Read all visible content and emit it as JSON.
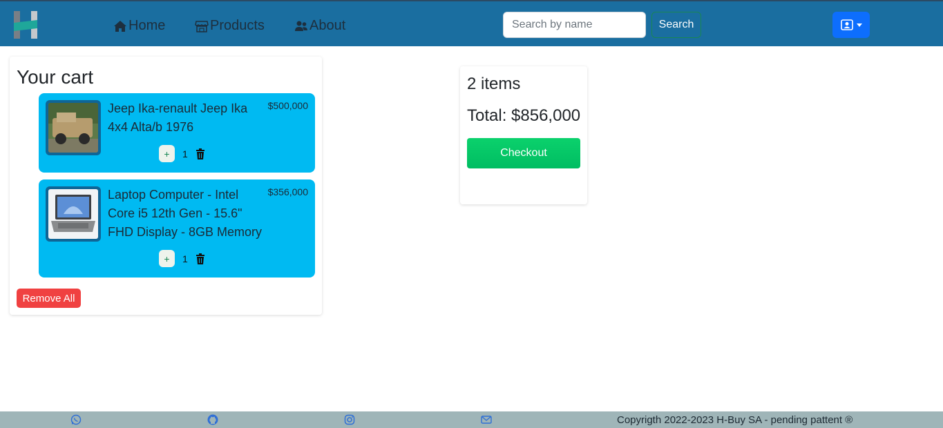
{
  "nav": {
    "home_label": "Home",
    "products_label": "Products",
    "about_label": "About",
    "search_placeholder": "Search by name",
    "search_button": "Search"
  },
  "cart": {
    "title": "Your cart",
    "items": [
      {
        "name": "Jeep Ika-renault Jeep Ika 4x4 Alta/b 1976",
        "price": "$500,000",
        "quantity": "1",
        "plus": "+"
      },
      {
        "name": "Laptop Computer - Intel Core i5 12th Gen - 15.6\" FHD Display - 8GB Memory",
        "price": "$356,000",
        "quantity": "1",
        "plus": "+"
      }
    ],
    "remove_all": "Remove All"
  },
  "summary": {
    "items_count": "2 items",
    "total": "Total: $856,000",
    "checkout": "Checkout"
  },
  "footer": {
    "icons": [
      "whatsapp-icon",
      "github-icon",
      "instagram-icon",
      "mail-icon"
    ],
    "copyright": "Copyrigth 2022-2023 H-Buy SA - pending pattent ®"
  },
  "colors": {
    "navbar": "#1a6ea0",
    "cart_item": "#00baf2",
    "checkout": "#00c866",
    "remove_all": "#f04141",
    "footer": "#9fb5b8",
    "user_button": "#0d6efd"
  }
}
